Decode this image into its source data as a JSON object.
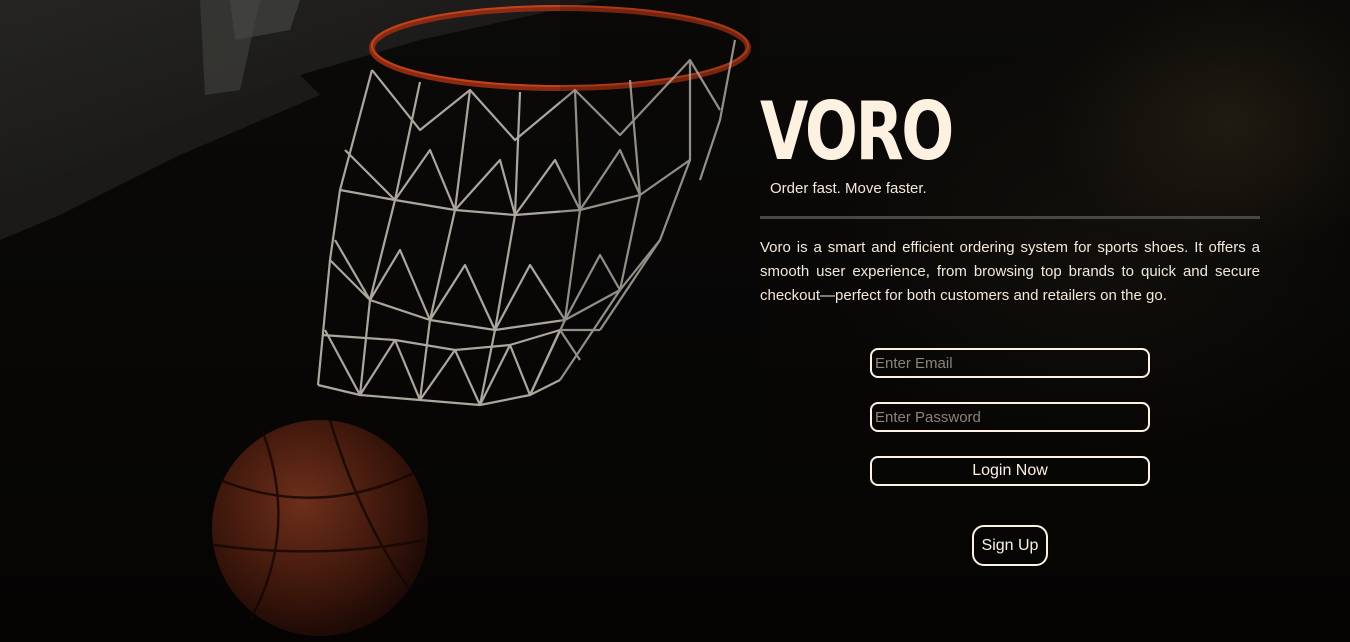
{
  "brand": {
    "title": "VORO",
    "tagline": "Order fast. Move faster."
  },
  "description": "Voro is a smart and efficient ordering system for sports shoes. It offers a smooth user experience, from browsing top brands to quick and secure checkout—perfect for both customers and retailers on the go.",
  "login": {
    "email_placeholder": "Enter Email",
    "email_value": "",
    "password_placeholder": "Enter Password",
    "password_value": "",
    "login_label": "Login Now"
  },
  "signup": {
    "label": "Sign Up"
  },
  "background": {
    "subject": "basketball falling through hoop net"
  },
  "colors": {
    "text": "#fdf1e2",
    "background": "#070605",
    "divider": "#4a4845"
  }
}
